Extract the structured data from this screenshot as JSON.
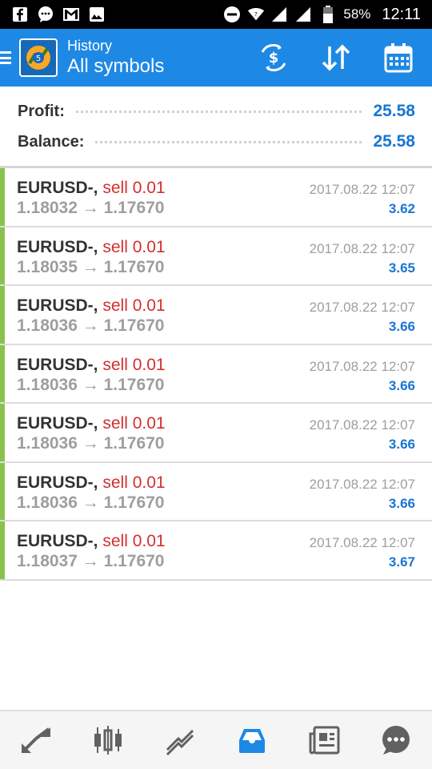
{
  "status_bar": {
    "battery": "58%",
    "time": "12:11"
  },
  "header": {
    "subtitle": "History",
    "title": "All symbols",
    "actions": [
      "currency-exchange-icon",
      "sort-icon",
      "calendar-icon"
    ]
  },
  "summary": {
    "profit_label": "Profit:",
    "profit_value": "25.58",
    "balance_label": "Balance:",
    "balance_value": "25.58"
  },
  "deals": [
    {
      "symbol": "EURUSD-,",
      "side": "sell 0.01",
      "prices": "1.18032 → 1.17670",
      "time": "2017.08.22 12:07",
      "profit": "3.62"
    },
    {
      "symbol": "EURUSD-,",
      "side": "sell 0.01",
      "prices": "1.18035 → 1.17670",
      "time": "2017.08.22 12:07",
      "profit": "3.65"
    },
    {
      "symbol": "EURUSD-,",
      "side": "sell 0.01",
      "prices": "1.18036 → 1.17670",
      "time": "2017.08.22 12:07",
      "profit": "3.66"
    },
    {
      "symbol": "EURUSD-,",
      "side": "sell 0.01",
      "prices": "1.18036 → 1.17670",
      "time": "2017.08.22 12:07",
      "profit": "3.66"
    },
    {
      "symbol": "EURUSD-,",
      "side": "sell 0.01",
      "prices": "1.18036 → 1.17670",
      "time": "2017.08.22 12:07",
      "profit": "3.66"
    },
    {
      "symbol": "EURUSD-,",
      "side": "sell 0.01",
      "prices": "1.18036 → 1.17670",
      "time": "2017.08.22 12:07",
      "profit": "3.66"
    },
    {
      "symbol": "EURUSD-,",
      "side": "sell 0.01",
      "prices": "1.18037 → 1.17670",
      "time": "2017.08.22 12:07",
      "profit": "3.67"
    }
  ],
  "bottom_nav": {
    "items": [
      "quotes-icon",
      "chart-icon",
      "trade-icon",
      "history-icon",
      "news-icon",
      "chat-icon"
    ],
    "active": "history-icon"
  },
  "colors": {
    "accent": "#1e88e5",
    "profit_blue": "#1976d2",
    "sell_red": "#d32f2f",
    "deal_bar_green": "#8bc34a"
  }
}
